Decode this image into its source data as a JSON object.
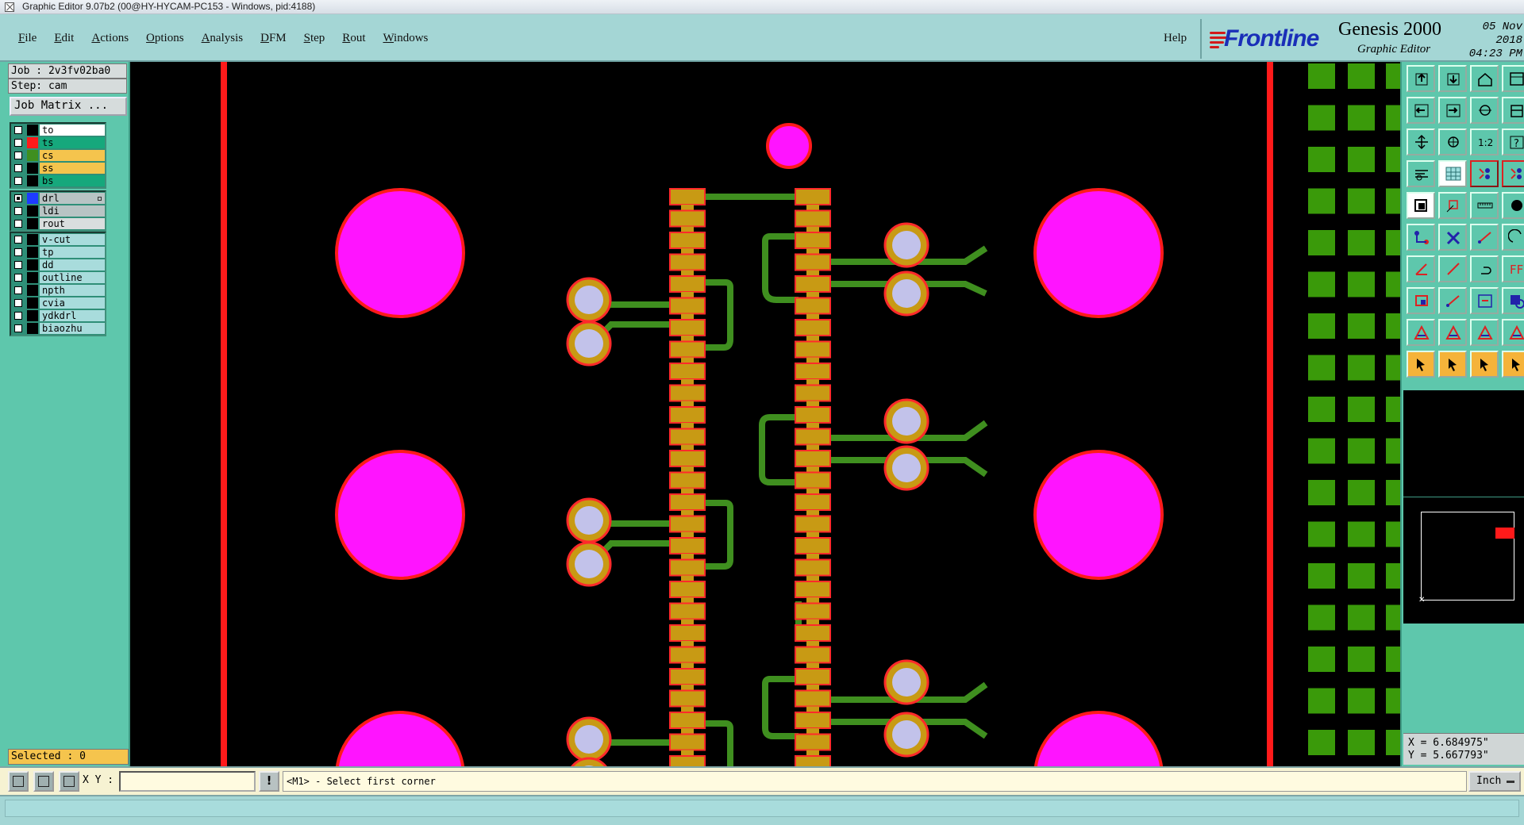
{
  "window": {
    "title": "Graphic Editor 9.07b2 (00@HY-HYCAM-PC153 - Windows, pid:4188)"
  },
  "menubar": {
    "items": [
      {
        "first": "F",
        "rest": "ile"
      },
      {
        "first": "E",
        "rest": "dit"
      },
      {
        "first": "A",
        "rest": "ctions"
      },
      {
        "first": "O",
        "rest": "ptions"
      },
      {
        "first": "A",
        "rest": "nalysis"
      },
      {
        "first": "D",
        "rest": "FM"
      },
      {
        "first": "S",
        "rest": "tep"
      },
      {
        "first": "R",
        "rest": "out"
      },
      {
        "first": "W",
        "rest": "indows"
      }
    ],
    "help": "Help"
  },
  "brand": {
    "company": "Frontline",
    "product": "Genesis 2000",
    "subtitle": "Graphic Editor",
    "date": "05 Nov 2018",
    "time": "04:23 PM"
  },
  "job": {
    "job_line": "Job : 2v3fv02ba0",
    "step_line": "Step: cam",
    "matrix_button": "Job Matrix ..."
  },
  "layers": {
    "group1": [
      {
        "name": "to",
        "swatch": "#000000",
        "bg": "#ffffff"
      },
      {
        "name": "ts",
        "swatch": "#ff1a1a",
        "bg": "#16a87c"
      },
      {
        "name": "cs",
        "swatch": "#3f8f1f",
        "bg": "#f5c44d"
      },
      {
        "name": "ss",
        "swatch": "#000000",
        "bg": "#f5c44d"
      },
      {
        "name": "bs",
        "swatch": "#000000",
        "bg": "#16a87c"
      }
    ],
    "group2": [
      {
        "name": "drl",
        "swatch": "#1e3cff",
        "bg": "#b8c4c4",
        "filled": true
      },
      {
        "name": "ldi",
        "swatch": "#000000",
        "bg": "#b8c4c4"
      },
      {
        "name": "rout",
        "swatch": "#000000",
        "bg": "#d9dede"
      }
    ],
    "group3": [
      {
        "name": "v-cut",
        "swatch": "#000000",
        "bg": "#a8dcdc"
      },
      {
        "name": "tp",
        "swatch": "#000000",
        "bg": "#a8dcdc"
      },
      {
        "name": "dd",
        "swatch": "#000000",
        "bg": "#a8dcdc"
      },
      {
        "name": "outline",
        "swatch": "#000000",
        "bg": "#a8dcdc"
      },
      {
        "name": "npth",
        "swatch": "#000000",
        "bg": "#a8dcdc"
      },
      {
        "name": "cvia",
        "swatch": "#000000",
        "bg": "#a8dcdc"
      },
      {
        "name": "ydkdrl",
        "swatch": "#000000",
        "bg": "#a8dcdc"
      },
      {
        "name": "biaozhu",
        "swatch": "#000000",
        "bg": "#a8dcdc"
      }
    ]
  },
  "selection": {
    "label": "Selected : 0"
  },
  "coordinates": {
    "x_line": "X = 6.684975\"",
    "y_line": "Y = 5.667793\""
  },
  "input": {
    "xy_label": "X Y :",
    "xy_value": "",
    "bang": "!",
    "prompt": "<M1> - Select first corner",
    "units": "Inch"
  },
  "colors": {
    "pad_gold": "#c89a14",
    "pad_border": "#ff2a2a",
    "trace_green": "#3f8f1f",
    "via_fill": "#c2c2ea",
    "hole_magenta": "#ff14ff",
    "border_red": "#ff1a1a",
    "green_squares": "#3a9a0a"
  }
}
